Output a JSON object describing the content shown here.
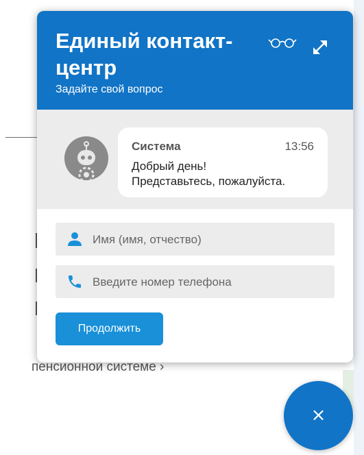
{
  "background": {
    "text": "пенсионной системе  ›"
  },
  "widget": {
    "title": "Единый контакт-центр",
    "subtitle": "Задайте свой вопрос",
    "icons": {
      "accessibility": "glasses-icon",
      "expand": "expand-icon",
      "name": "person-icon",
      "phone": "phone-icon",
      "close": "close-icon",
      "avatar": "robot-icon"
    },
    "colors": {
      "header": "#1174c6",
      "button": "#1990d8",
      "chat_bg": "#ececec"
    }
  },
  "message": {
    "sender": "Система",
    "time": "13:56",
    "line1": "Добрый день!",
    "line2": "Представьтесь, пожалуйста."
  },
  "form": {
    "name_placeholder": "Имя (имя, отчество)",
    "phone_placeholder": "Введите номер телефона",
    "continue_label": "Продолжить"
  },
  "fab": {
    "close_glyph": "×"
  }
}
